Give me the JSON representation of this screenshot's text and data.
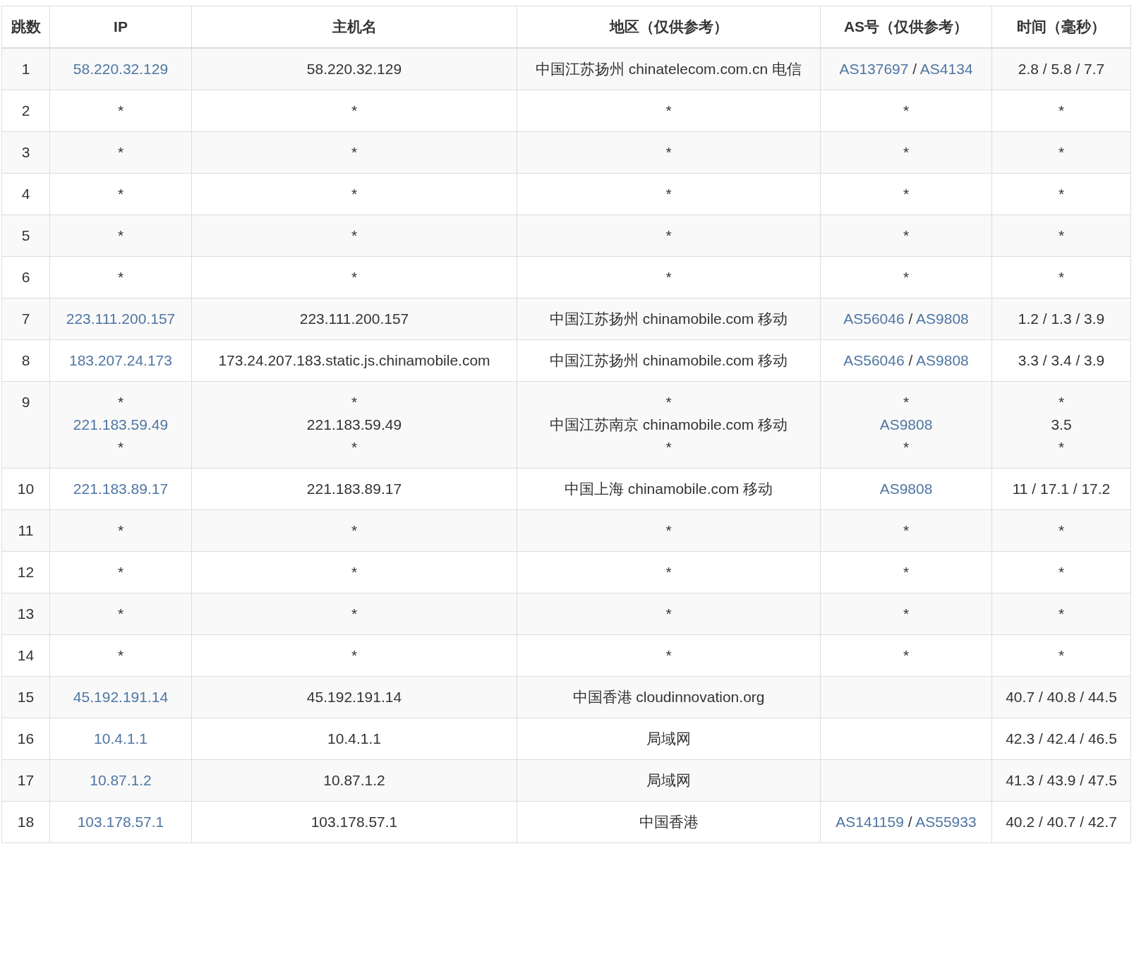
{
  "columns": [
    "跳数",
    "IP",
    "主机名",
    "地区（仅供参考）",
    "AS号（仅供参考）",
    "时间（毫秒）"
  ],
  "rows": [
    {
      "hop": "1",
      "ip": [
        {
          "text": "58.220.32.129",
          "link": true
        }
      ],
      "host": [
        "58.220.32.129"
      ],
      "region": [
        "中国江苏扬州 chinatelecom.com.cn 电信"
      ],
      "as": [
        [
          {
            "text": "AS137697",
            "link": true
          },
          {
            "text": "/",
            "link": false
          },
          {
            "text": "AS4134",
            "link": true
          }
        ]
      ],
      "time": [
        "2.8 / 5.8 / 7.7"
      ]
    },
    {
      "hop": "2",
      "ip": [
        {
          "text": "*",
          "link": false
        }
      ],
      "host": [
        "*"
      ],
      "region": [
        "*"
      ],
      "as": [
        [
          {
            "text": "*",
            "link": false
          }
        ]
      ],
      "time": [
        "*"
      ]
    },
    {
      "hop": "3",
      "ip": [
        {
          "text": "*",
          "link": false
        }
      ],
      "host": [
        "*"
      ],
      "region": [
        "*"
      ],
      "as": [
        [
          {
            "text": "*",
            "link": false
          }
        ]
      ],
      "time": [
        "*"
      ]
    },
    {
      "hop": "4",
      "ip": [
        {
          "text": "*",
          "link": false
        }
      ],
      "host": [
        "*"
      ],
      "region": [
        "*"
      ],
      "as": [
        [
          {
            "text": "*",
            "link": false
          }
        ]
      ],
      "time": [
        "*"
      ]
    },
    {
      "hop": "5",
      "ip": [
        {
          "text": "*",
          "link": false
        }
      ],
      "host": [
        "*"
      ],
      "region": [
        "*"
      ],
      "as": [
        [
          {
            "text": "*",
            "link": false
          }
        ]
      ],
      "time": [
        "*"
      ]
    },
    {
      "hop": "6",
      "ip": [
        {
          "text": "*",
          "link": false
        }
      ],
      "host": [
        "*"
      ],
      "region": [
        "*"
      ],
      "as": [
        [
          {
            "text": "*",
            "link": false
          }
        ]
      ],
      "time": [
        "*"
      ]
    },
    {
      "hop": "7",
      "ip": [
        {
          "text": "223.111.200.157",
          "link": true
        }
      ],
      "host": [
        "223.111.200.157"
      ],
      "region": [
        "中国江苏扬州 chinamobile.com 移动"
      ],
      "as": [
        [
          {
            "text": "AS56046",
            "link": true
          },
          {
            "text": "/",
            "link": false
          },
          {
            "text": "AS9808",
            "link": true
          }
        ]
      ],
      "time": [
        "1.2 / 1.3 / 3.9"
      ]
    },
    {
      "hop": "8",
      "ip": [
        {
          "text": "183.207.24.173",
          "link": true
        }
      ],
      "host": [
        "173.24.207.183.static.js.chinamobile.com"
      ],
      "region": [
        "中国江苏扬州 chinamobile.com 移动"
      ],
      "as": [
        [
          {
            "text": "AS56046",
            "link": true
          },
          {
            "text": "/",
            "link": false
          },
          {
            "text": "AS9808",
            "link": true
          }
        ]
      ],
      "time": [
        "3.3 / 3.4 / 3.9"
      ]
    },
    {
      "hop": "9",
      "ip": [
        {
          "text": "*",
          "link": false
        },
        {
          "text": "221.183.59.49",
          "link": true
        },
        {
          "text": "*",
          "link": false
        }
      ],
      "host": [
        "*",
        "221.183.59.49",
        "*"
      ],
      "region": [
        "*",
        "中国江苏南京 chinamobile.com 移动",
        "*"
      ],
      "as": [
        [
          {
            "text": "*",
            "link": false
          }
        ],
        [
          {
            "text": "AS9808",
            "link": true
          }
        ],
        [
          {
            "text": "*",
            "link": false
          }
        ]
      ],
      "time": [
        "*",
        "3.5",
        "*"
      ]
    },
    {
      "hop": "10",
      "ip": [
        {
          "text": "221.183.89.17",
          "link": true
        }
      ],
      "host": [
        "221.183.89.17"
      ],
      "region": [
        "中国上海 chinamobile.com 移动"
      ],
      "as": [
        [
          {
            "text": "AS9808",
            "link": true
          }
        ]
      ],
      "time": [
        "11 / 17.1 / 17.2"
      ]
    },
    {
      "hop": "11",
      "ip": [
        {
          "text": "*",
          "link": false
        }
      ],
      "host": [
        "*"
      ],
      "region": [
        "*"
      ],
      "as": [
        [
          {
            "text": "*",
            "link": false
          }
        ]
      ],
      "time": [
        "*"
      ]
    },
    {
      "hop": "12",
      "ip": [
        {
          "text": "*",
          "link": false
        }
      ],
      "host": [
        "*"
      ],
      "region": [
        "*"
      ],
      "as": [
        [
          {
            "text": "*",
            "link": false
          }
        ]
      ],
      "time": [
        "*"
      ]
    },
    {
      "hop": "13",
      "ip": [
        {
          "text": "*",
          "link": false
        }
      ],
      "host": [
        "*"
      ],
      "region": [
        "*"
      ],
      "as": [
        [
          {
            "text": "*",
            "link": false
          }
        ]
      ],
      "time": [
        "*"
      ]
    },
    {
      "hop": "14",
      "ip": [
        {
          "text": "*",
          "link": false
        }
      ],
      "host": [
        "*"
      ],
      "region": [
        "*"
      ],
      "as": [
        [
          {
            "text": "*",
            "link": false
          }
        ]
      ],
      "time": [
        "*"
      ]
    },
    {
      "hop": "15",
      "ip": [
        {
          "text": "45.192.191.14",
          "link": true
        }
      ],
      "host": [
        "45.192.191.14"
      ],
      "region": [
        "中国香港 cloudinnovation.org"
      ],
      "time": [
        "40.7 / 40.8 / 44.5"
      ]
    },
    {
      "hop": "16",
      "ip": [
        {
          "text": "10.4.1.1",
          "link": true
        }
      ],
      "host": [
        "10.4.1.1"
      ],
      "region": [
        "局域网"
      ],
      "time": [
        "42.3 / 42.4 / 46.5"
      ]
    },
    {
      "hop": "17",
      "ip": [
        {
          "text": "10.87.1.2",
          "link": true
        }
      ],
      "host": [
        "10.87.1.2"
      ],
      "region": [
        "局域网"
      ],
      "time": [
        "41.3 / 43.9 / 47.5"
      ]
    },
    {
      "hop": "18",
      "ip": [
        {
          "text": "103.178.57.1",
          "link": true
        }
      ],
      "host": [
        "103.178.57.1"
      ],
      "region": [
        "中国香港"
      ],
      "as": [
        [
          {
            "text": "AS141159",
            "link": true
          },
          {
            "text": "/",
            "link": false
          },
          {
            "text": "AS55933",
            "link": true
          }
        ]
      ],
      "time": [
        "40.2 / 40.7 / 42.7"
      ]
    }
  ]
}
